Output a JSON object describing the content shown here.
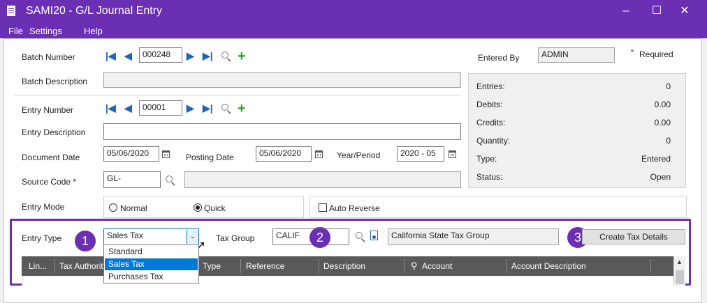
{
  "window": {
    "title": "SAMI20 - G/L Journal Entry",
    "minimize": "–",
    "maximize": "☐",
    "close": "✕"
  },
  "menu": {
    "file": "File",
    "settings": "Settings",
    "help": "Help"
  },
  "batch": {
    "label": "Batch Number",
    "number": "000248",
    "desc_label": "Batch Description",
    "desc_value": ""
  },
  "entry": {
    "label": "Entry Number",
    "number": "00001",
    "desc_label": "Entry Description",
    "desc_value": ""
  },
  "dates": {
    "doc_label": "Document Date",
    "doc_value": "05/06/2020",
    "post_label": "Posting Date",
    "post_value": "05/06/2020",
    "period_label": "Year/Period",
    "period_value": "2020 - 05"
  },
  "source": {
    "label": "Source Code *",
    "value": "GL-",
    "desc_value": ""
  },
  "entered_by": {
    "label": "Entered By",
    "value": "ADMIN",
    "required_note": "Required",
    "required_star": "*"
  },
  "stats": [
    {
      "label": "Entries:",
      "value": "0"
    },
    {
      "label": "Debits:",
      "value": "0.00"
    },
    {
      "label": "Credits:",
      "value": "0.00"
    },
    {
      "label": "Quantity:",
      "value": "0"
    },
    {
      "label": "Type:",
      "value": "Entered"
    },
    {
      "label": "Status:",
      "value": "Open"
    }
  ],
  "entry_mode": {
    "label": "Entry Mode",
    "normal": "Normal",
    "quick": "Quick",
    "selected": "Quick"
  },
  "auto_reverse": {
    "label": "Auto Reverse",
    "checked": false
  },
  "entry_type": {
    "label": "Entry Type",
    "value": "Sales Tax",
    "options": [
      "Standard",
      "Sales Tax",
      "Purchases Tax"
    ]
  },
  "tax_group": {
    "label": "Tax Group",
    "value": "CALIF",
    "desc": "California State Tax Group"
  },
  "create_tax_button": "Create Tax Details",
  "badges": [
    "1",
    "2",
    "3"
  ],
  "grid": {
    "columns": [
      "Lin...",
      "Tax Authorit",
      "Type",
      "Reference",
      "Description",
      "Account",
      "Account Description"
    ]
  },
  "colors": {
    "accent": "#6b2fb3",
    "nav": "#1f63b8",
    "add": "#2a9d2a",
    "selection": "#0078d7"
  }
}
